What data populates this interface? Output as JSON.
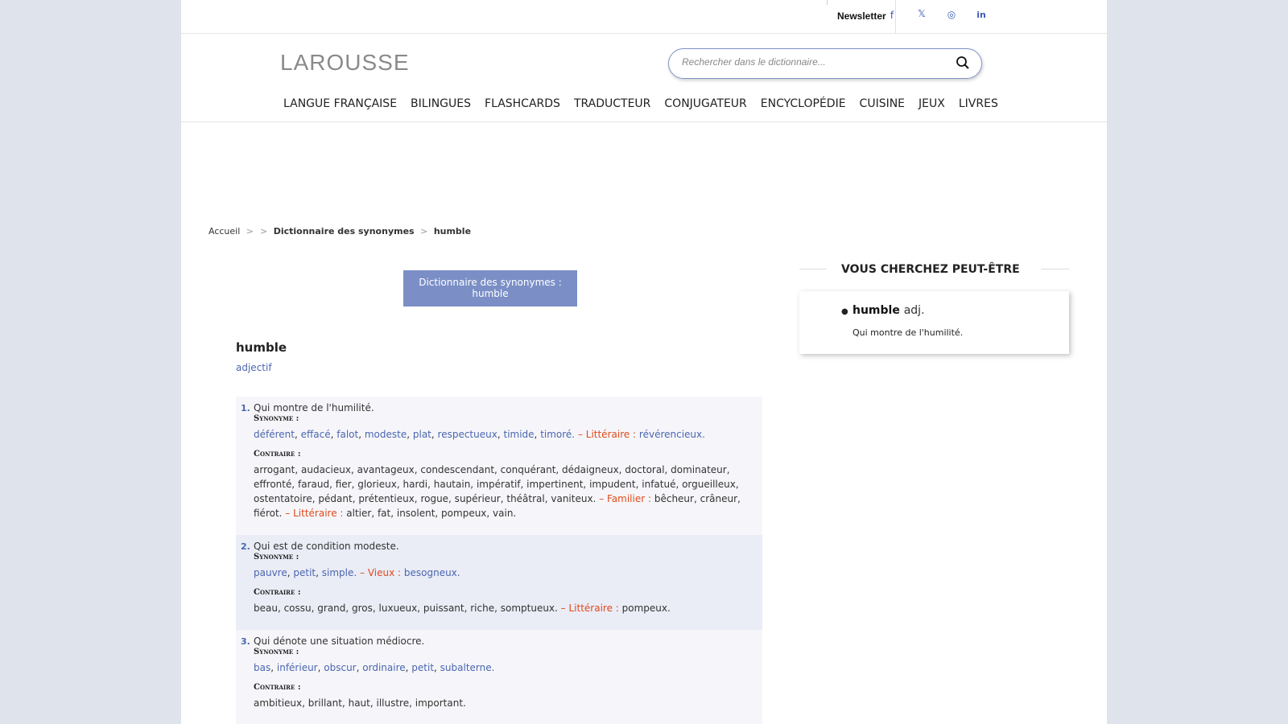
{
  "topbar": {
    "newsletter": "Newsletter",
    "social": [
      "facebook-icon",
      "x-icon",
      "instagram-icon",
      "linkedin-icon"
    ],
    "social_glyphs": [
      "f",
      "𝕏",
      "◎",
      "in"
    ]
  },
  "header": {
    "logo": "LAROUSSE",
    "search_placeholder": "Rechercher dans le dictionnaire..."
  },
  "nav": [
    "LANGUE FRANÇAISE",
    "BILINGUES",
    "FLASHCARDS",
    "TRADUCTEUR",
    "CONJUGATEUR",
    "ENCYCLOPÉDIE",
    "CUISINE",
    "JEUX",
    "LIVRES"
  ],
  "breadcrumb": {
    "home": "Accueil",
    "sep": ">",
    "section": "Dictionnaire des synonymes",
    "current": "humble"
  },
  "title_box": {
    "line1": "Dictionnaire des synonymes :",
    "line2": "humble"
  },
  "entry": {
    "headword": "humble",
    "pos": "adjectif",
    "synonym_label": "Synonyme :",
    "contrary_label": "Contraire :",
    "senses": [
      {
        "num": "1.",
        "def": "Qui montre de l'humilité.",
        "syn": [
          [
            "déférent",
            "link"
          ],
          [
            ", ",
            "txt"
          ],
          [
            "effacé",
            "link"
          ],
          [
            ", ",
            "txt"
          ],
          [
            "falot",
            "link"
          ],
          [
            ", ",
            "txt"
          ],
          [
            "modeste",
            "link"
          ],
          [
            ", ",
            "txt"
          ],
          [
            "plat",
            "link"
          ],
          [
            ", ",
            "txt"
          ],
          [
            "respectueux",
            "link"
          ],
          [
            ", ",
            "txt"
          ],
          [
            "timide",
            "link"
          ],
          [
            ", ",
            "txt"
          ],
          [
            "timoré.",
            "link"
          ],
          [
            " – Littéraire : ",
            "reg"
          ],
          [
            "révérencieux.",
            "link"
          ]
        ],
        "con": [
          [
            "arrogant, audacieux, avantageux, condescendant, conquérant, dédaigneux, doctoral, dominateur, effronté, faraud, fier, glorieux, hardi, hautain, impératif, impertinent, impudent, infatué, orgueilleux, ostentatoire, pédant, prétentieux, rogue, supérieur, théâtral, vaniteux.",
            "txt"
          ],
          [
            " – Familier : ",
            "reg"
          ],
          [
            "bêcheur, crâneur, fiérot.",
            "txt"
          ],
          [
            " – Littéraire : ",
            "reg"
          ],
          [
            "altier, fat, insolent, pompeux, vain.",
            "txt"
          ]
        ]
      },
      {
        "num": "2.",
        "def": "Qui est de condition modeste.",
        "syn": [
          [
            "pauvre",
            "link"
          ],
          [
            ", ",
            "txt"
          ],
          [
            "petit",
            "link"
          ],
          [
            ", ",
            "txt"
          ],
          [
            "simple.",
            "link"
          ],
          [
            " – Vieux : ",
            "reg"
          ],
          [
            "besogneux.",
            "link"
          ]
        ],
        "con": [
          [
            "beau, cossu, grand, gros, luxueux, puissant, riche, somptueux.",
            "txt"
          ],
          [
            " – Littéraire : ",
            "reg"
          ],
          [
            "pompeux.",
            "txt"
          ]
        ]
      },
      {
        "num": "3.",
        "def": "Qui dénote une situation médiocre.",
        "syn": [
          [
            "bas",
            "link"
          ],
          [
            ", ",
            "txt"
          ],
          [
            "inférieur",
            "link"
          ],
          [
            ", ",
            "txt"
          ],
          [
            "obscur",
            "link"
          ],
          [
            ", ",
            "txt"
          ],
          [
            "ordinaire",
            "link"
          ],
          [
            ", ",
            "txt"
          ],
          [
            "petit",
            "link"
          ],
          [
            ", ",
            "txt"
          ],
          [
            "subalterne.",
            "link"
          ]
        ],
        "con": [
          [
            "ambitieux, brillant, haut, illustre, important.",
            "txt"
          ]
        ]
      }
    ]
  },
  "sidebar": {
    "heading": "VOUS CHERCHEZ PEUT-ÊTRE",
    "item_word": "humble",
    "item_pos": "adj.",
    "item_def": "Qui montre de l'humilité."
  },
  "colors": {
    "accent": "#4a66b0",
    "register": "#e04a1a",
    "title_box": "#7b8fc6"
  }
}
